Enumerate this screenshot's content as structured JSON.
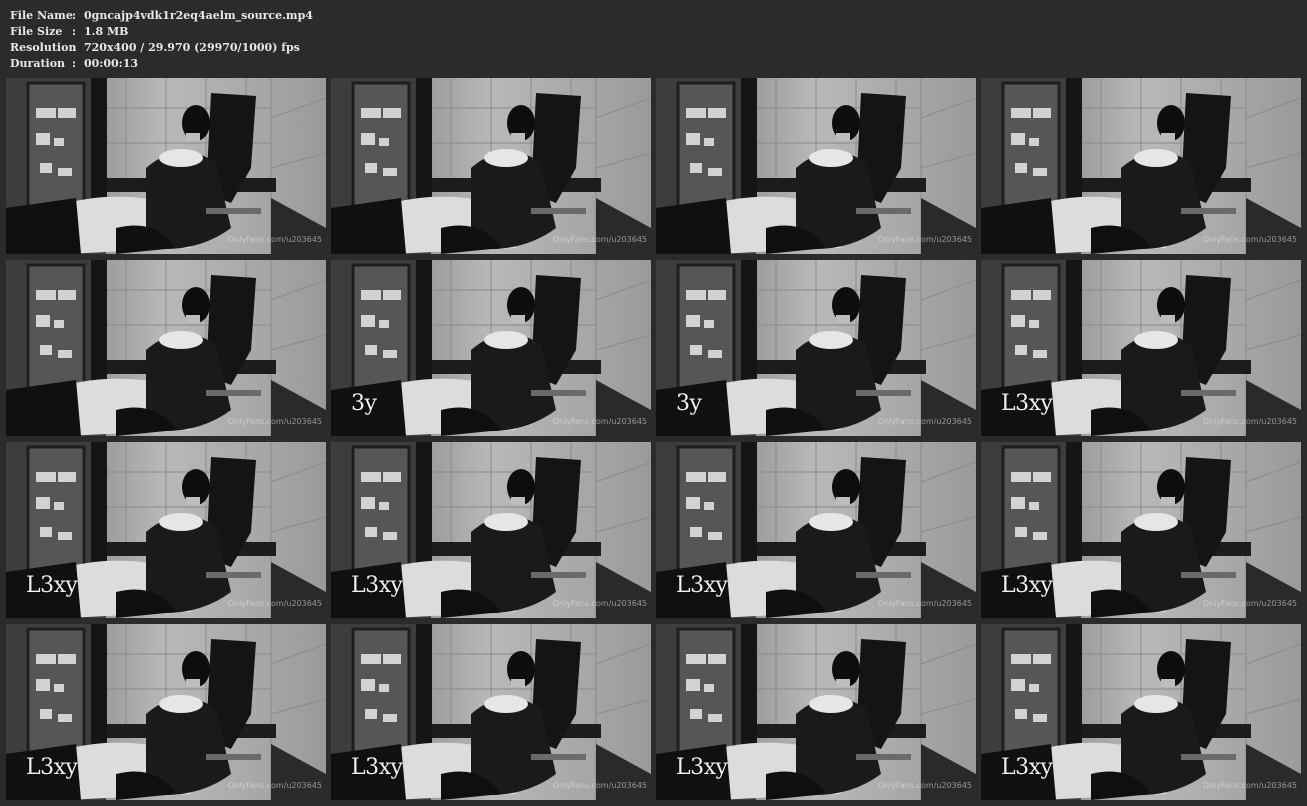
{
  "meta": {
    "rows": [
      {
        "label": "File Name",
        "value": "0gncajp4vdk1r2eq4aelm_source.mp4"
      },
      {
        "label": "File Size",
        "value": "1.8 MB"
      },
      {
        "label": "Resolution",
        "value": "720x400 / 29.970 (29970/1000) fps"
      },
      {
        "label": "Duration",
        "value": "00:00:13"
      }
    ],
    "separator": ":"
  },
  "thumbnails": [
    {
      "label": "",
      "watermark": "OnlyFans.com/u203645"
    },
    {
      "label": "",
      "watermark": "OnlyFans.com/u203645"
    },
    {
      "label": "",
      "watermark": "OnlyFans.com/u203645"
    },
    {
      "label": "",
      "watermark": "OnlyFans.com/u203645"
    },
    {
      "label": "",
      "watermark": "OnlyFans.com/u203645"
    },
    {
      "label": "3y",
      "watermark": "OnlyFans.com/u203645"
    },
    {
      "label": "3y",
      "watermark": "OnlyFans.com/u203645"
    },
    {
      "label": "L3xy",
      "watermark": "OnlyFans.com/u203645"
    },
    {
      "label": "L3xy",
      "watermark": "OnlyFans.com/u203645"
    },
    {
      "label": "L3xy",
      "watermark": "OnlyFans.com/u203645"
    },
    {
      "label": "L3xy",
      "watermark": "OnlyFans.com/u203645"
    },
    {
      "label": "L3xy",
      "watermark": "OnlyFans.com/u203645"
    },
    {
      "label": "L3xy",
      "watermark": "OnlyFans.com/u203645"
    },
    {
      "label": "L3xy",
      "watermark": "OnlyFans.com/u203645"
    },
    {
      "label": "L3xy",
      "watermark": "OnlyFans.com/u203645"
    },
    {
      "label": "L3xy",
      "watermark": "OnlyFans.com/u203645"
    }
  ]
}
